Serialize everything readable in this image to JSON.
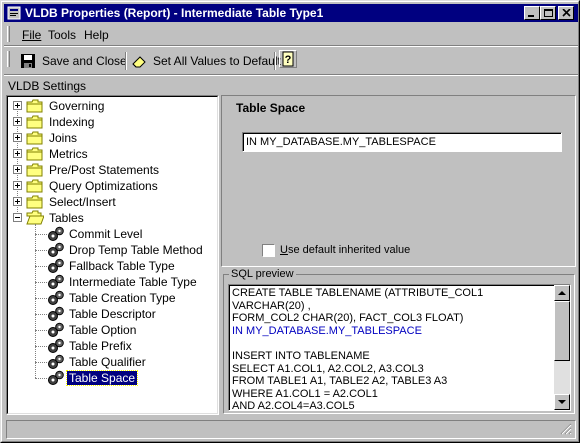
{
  "window": {
    "title": "VLDB Properties (Report) - Intermediate Table Type1"
  },
  "menu": {
    "items": [
      "File",
      "Tools",
      "Help"
    ]
  },
  "toolbar": {
    "save_close_label": "Save and Close",
    "set_all_default_label": "Set All Values to Default"
  },
  "settings_label": "VLDB Settings",
  "tree": {
    "categories": [
      "Governing",
      "Indexing",
      "Joins",
      "Metrics",
      "Pre/Post Statements",
      "Query Optimizations",
      "Select/Insert",
      "Tables"
    ],
    "tables_children": [
      "Commit Level",
      "Drop Temp Table Method",
      "Fallback Table Type",
      "Intermediate Table Type",
      "Table Creation Type",
      "Table Descriptor",
      "Table Option",
      "Table Prefix",
      "Table Qualifier",
      "Table Space"
    ],
    "selected": "Table Space"
  },
  "panel": {
    "heading": "Table Space",
    "value": "IN MY_DATABASE.MY_TABLESPACE",
    "use_default_label": "Use default inherited value",
    "use_default_checked": false
  },
  "sql_preview": {
    "label": "SQL preview",
    "lines": [
      {
        "text": "CREATE  TABLE  TABLENAME (ATTRIBUTE_COL1",
        "highlight": false
      },
      {
        "text": "VARCHAR(20) ,",
        "highlight": false
      },
      {
        "text": "FORM_COL2 CHAR(20), FACT_COL3 FLOAT)",
        "highlight": false
      },
      {
        "text": "IN MY_DATABASE.MY_TABLESPACE",
        "highlight": true
      },
      {
        "text": "",
        "highlight": false
      },
      {
        "text": "INSERT INTO TABLENAME",
        "highlight": false
      },
      {
        "text": "SELECT  A1.COL1, A2.COL2, A3.COL3",
        "highlight": false
      },
      {
        "text": "FROM TABLE1 A1, TABLE2 A2, TABLE3 A3",
        "highlight": false
      },
      {
        "text": "WHERE A1.COL1 = A2.COL1",
        "highlight": false
      },
      {
        "text": "AND A2.COL4=A3.COL5",
        "highlight": false
      }
    ]
  },
  "colors": {
    "titlebar": "#000080",
    "face": "#c0c0c0",
    "selection": "#000080",
    "sql_highlight": "#0000c0"
  }
}
